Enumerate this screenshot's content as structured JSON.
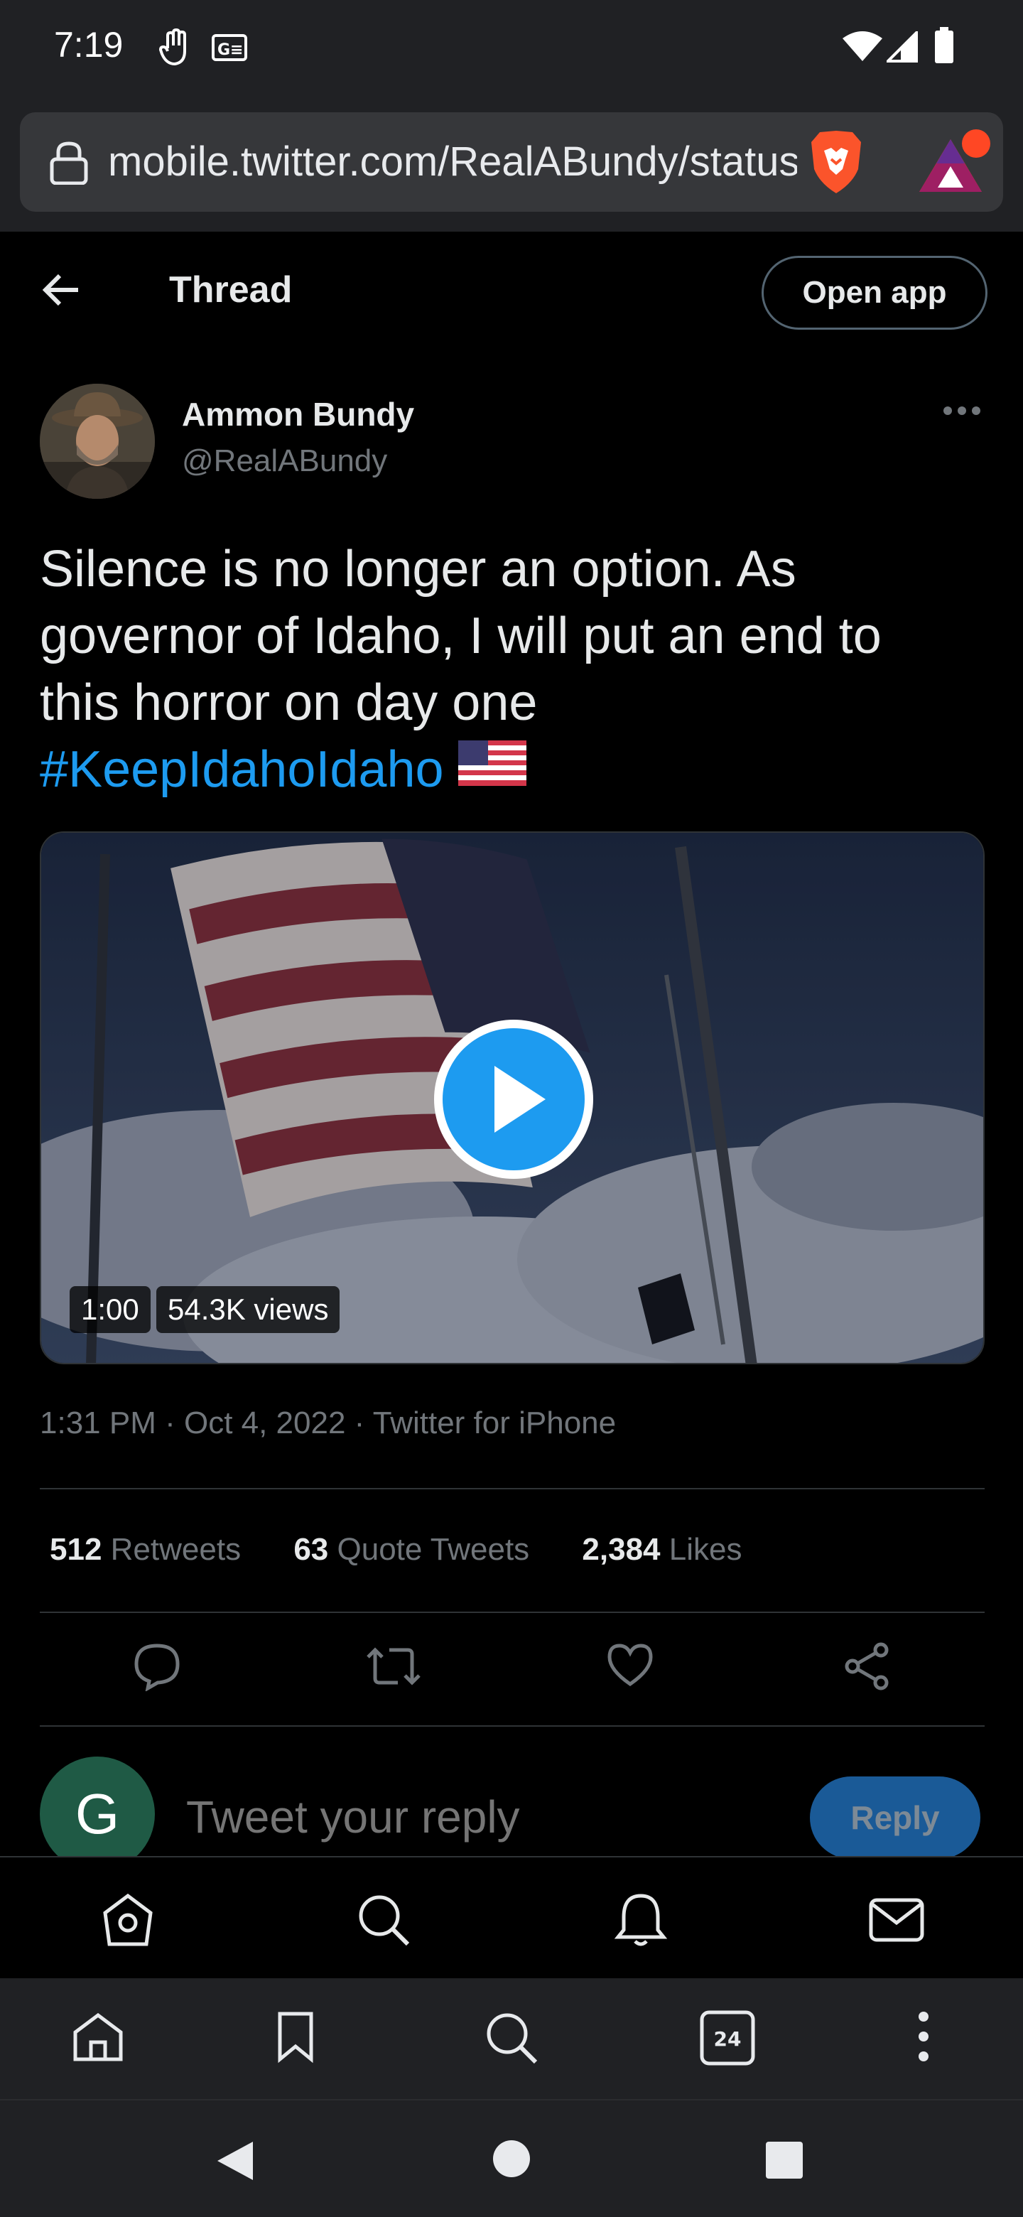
{
  "status_bar": {
    "time": "7:19"
  },
  "browser": {
    "url": "mobile.twitter.com/RealABundy/status"
  },
  "header": {
    "title": "Thread",
    "open_app_label": "Open app"
  },
  "tweet": {
    "author_name": "Ammon Bundy",
    "author_handle": "@RealABundy",
    "text_line1": "Silence is no longer an option. As",
    "text_line2": "governor of Idaho, I will put an end to",
    "text_line3": "this horror on day one",
    "hashtag": "#KeepIdahoIdaho",
    "video": {
      "duration": "1:00",
      "views": "54.3K views"
    },
    "meta": "1:31 PM · Oct 4, 2022 · Twitter for iPhone",
    "stats": [
      {
        "count": "512",
        "label": "Retweets"
      },
      {
        "count": "63",
        "label": "Quote Tweets"
      },
      {
        "count": "2,384",
        "label": "Likes"
      }
    ]
  },
  "reply": {
    "avatar_letter": "G",
    "placeholder": "Tweet your reply",
    "button_label": "Reply"
  },
  "browser_nav": {
    "tab_count": "24"
  },
  "colors": {
    "accent": "#1d9bf0",
    "reply_button": "#1a5a97",
    "browser_chrome": "#202124"
  }
}
